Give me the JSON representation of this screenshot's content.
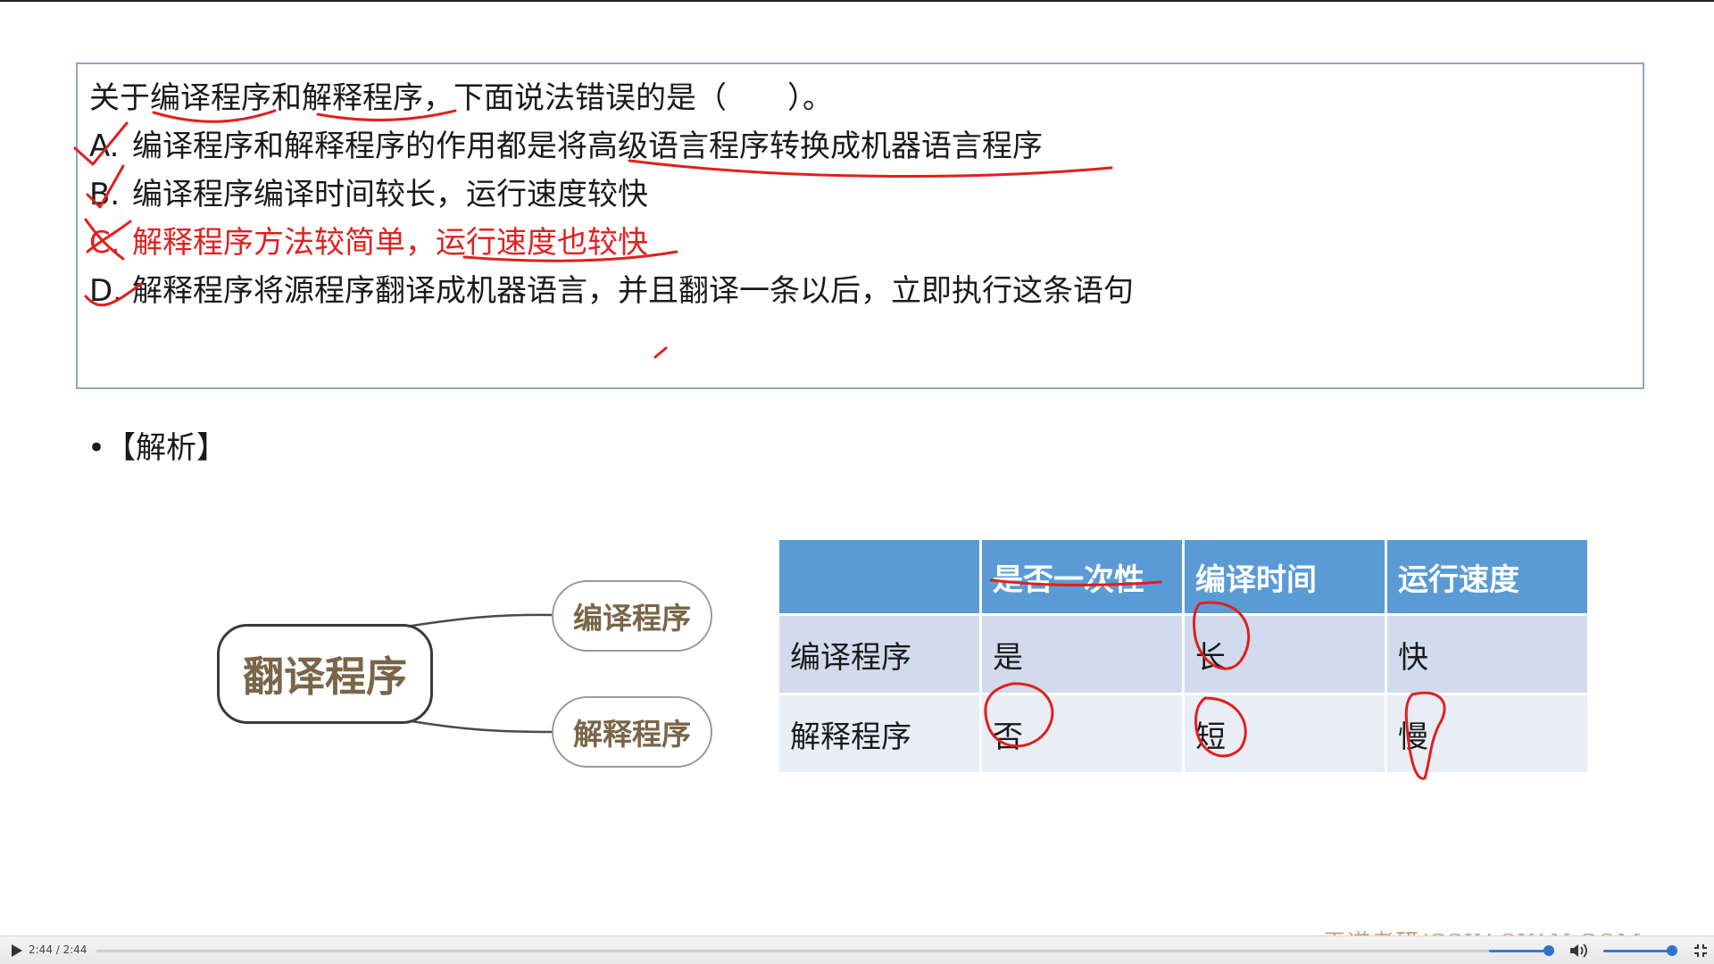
{
  "question": {
    "stem": "关于编译程序和解释程序，下面说法错误的是（　　）。",
    "options": [
      {
        "letter": "A.",
        "text": "编译程序和解释程序的作用都是将高级语言程序转换成机器语言程序"
      },
      {
        "letter": "B.",
        "text": "编译程序编译时间较长，运行速度较快"
      },
      {
        "letter": "C.",
        "text": "解释程序方法较简单，运行速度也较快"
      },
      {
        "letter": "D.",
        "text": "解释程序将源程序翻译成机器语言，并且翻译一条以后，立即执行这条语句"
      }
    ]
  },
  "analysis": {
    "bullet": "•",
    "title": "【解析】"
  },
  "mindmap": {
    "root": "翻译程序",
    "children": [
      "编译程序",
      "解释程序"
    ]
  },
  "table": {
    "headers": [
      "",
      "是否一次性",
      "编译时间",
      "运行速度"
    ],
    "rows": [
      [
        "编译程序",
        "是",
        "长",
        "快"
      ],
      [
        "解释程序",
        "否",
        "短",
        "慢"
      ]
    ]
  },
  "watermark": "王道考研/CSKAOYAN.COM",
  "player": {
    "time": "2:44 / 2:44",
    "progress": 1.0,
    "volume": 0.9
  },
  "colors": {
    "accent_red": "#e0201c",
    "table_header": "#5b9bd5",
    "progress_blue": "#3478d4"
  },
  "icons": {
    "play": "play-icon",
    "volume": "speaker-icon",
    "fullscreen": "exit-fullscreen-icon"
  }
}
